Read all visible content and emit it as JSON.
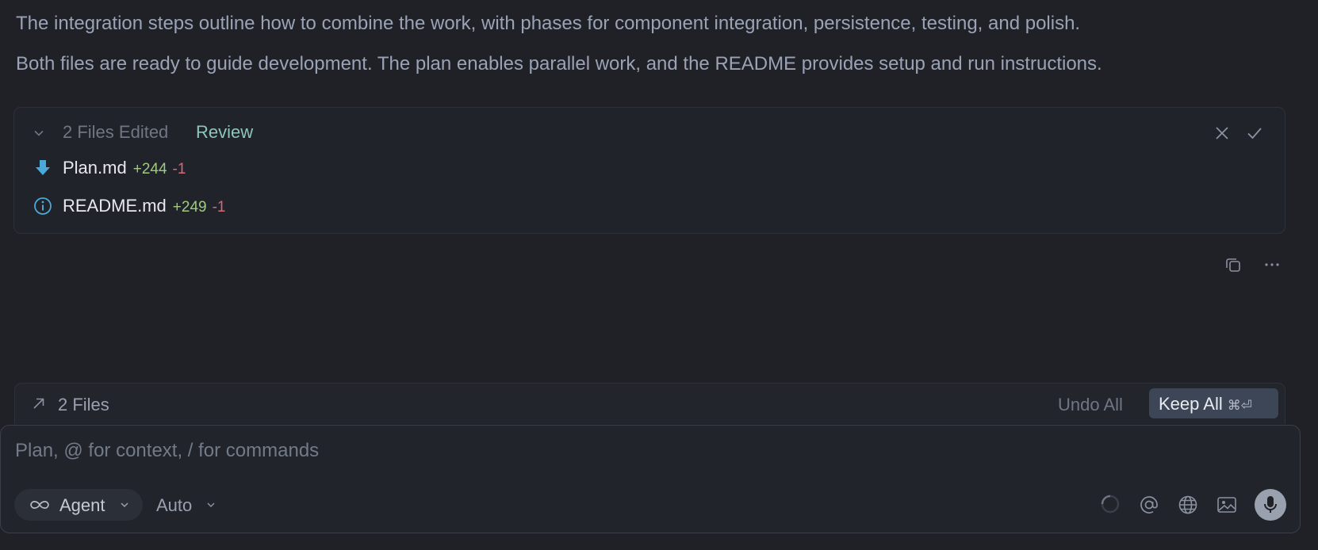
{
  "message": {
    "paragraph1": "The integration steps outline how to combine the work, with phases for component integration, persistence, testing, and polish.",
    "paragraph2": "Both files are ready to guide development. The plan enables parallel work, and the README provides setup and run instructions."
  },
  "files_edited": {
    "title": "2 Files Edited",
    "review_label": "Review",
    "files": [
      {
        "name": "Plan.md",
        "added": "+244",
        "removed": "-1",
        "icon": "download-arrow-icon"
      },
      {
        "name": "README.md",
        "added": "+249",
        "removed": "-1",
        "icon": "info-icon"
      }
    ]
  },
  "files_bar": {
    "count_label": "2 Files",
    "undo_label": "Undo All",
    "keep_label": "Keep All",
    "keep_shortcut": "⌘⏎"
  },
  "composer": {
    "placeholder": "Plan, @ for context, / for commands",
    "mode_label": "Agent",
    "model_label": "Auto"
  },
  "colors": {
    "background": "#1f2127",
    "added": "#9fca7f",
    "removed": "#d46a78",
    "review": "#8dc7b8",
    "keep_button": "#3d4656"
  }
}
